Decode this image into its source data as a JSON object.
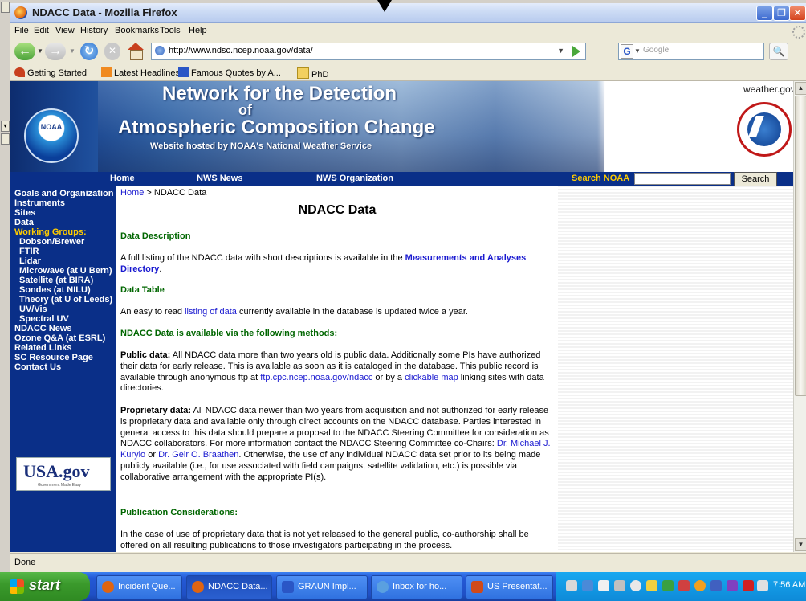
{
  "browser": {
    "title": "NDACC Data - Mozilla Firefox",
    "menu": [
      "File",
      "Edit",
      "View",
      "History",
      "Bookmarks",
      "Tools",
      "Help"
    ],
    "url": "http://www.ndsc.ncep.noaa.gov/data/",
    "search_placeholder": "Google",
    "bookmarks": [
      "Getting Started",
      "Latest Headlines",
      "Famous Quotes by A...",
      "PhD"
    ],
    "status": "Done"
  },
  "banner": {
    "line1": "Network for the Detection",
    "line2": "of",
    "line3": "Atmospheric Composition Change",
    "hosted": "Website hosted by NOAA's National Weather Service",
    "weather_gov": "weather.gov",
    "noaa_label": "NOAA"
  },
  "topnav": {
    "home": "Home",
    "nws_news": "NWS News",
    "nws_org": "NWS Organization",
    "search_label": "Search NOAA",
    "search_button": "Search"
  },
  "leftnav": {
    "items": [
      "Goals and Organization",
      "Instruments",
      "Sites",
      "Data",
      "Working Groups:",
      "Dobson/Brewer",
      "FTIR",
      "Lidar",
      "Microwave (at U Bern)",
      "Satellite (at BIRA)",
      "Sondes (at NILU)",
      "Theory (at U of Leeds)",
      "UV/Vis",
      "Spectral UV",
      "NDACC News",
      "Ozone Q&A (at ESRL)",
      "Related Links",
      "SC Resource Page",
      "Contact Us"
    ],
    "usagov": "USA.gov",
    "usagov_tag": "Government Made Easy"
  },
  "main": {
    "breadcrumb_home": "Home",
    "breadcrumb_rest": " > NDACC Data",
    "title": "NDACC Data",
    "h_desc": "Data Description",
    "desc_text": "A full listing of the NDACC data with short descriptions is available in the ",
    "desc_link": "Measurements and Analyses Directory",
    "h_table": "Data Table",
    "table_pre": "An easy to read ",
    "table_link": "listing of data",
    "table_post": " currently available in the database is updated twice a year.",
    "h_methods": "NDACC Data is available via the following methods:",
    "public_label": "Public data:",
    "public_text": " All NDACC data more than two years old is public data.  Additionally some PIs have authorized their data for early release.  This is available as soon as it is cataloged in the database.  This public record is available through anonymous ftp at ",
    "public_ftp": "ftp.cpc.ncep.noaa.gov/ndacc",
    "public_mid": " or by a ",
    "public_map": "clickable map",
    "public_end": " linking sites with data directories.",
    "prop_label": "Proprietary data:",
    "prop_text": " All NDACC data newer than two years from acquisition and not authorized for early release is proprietary data and available only through direct accounts on the NDACC database.  Parties interested in general access to this data should prepare a proposal to the NDACC Steering Committee for consideration as NDACC collaborators.  For more information contact the NDACC Steering Committee co-Chairs:  ",
    "prop_link1": "Dr. Michael J. Kurylo",
    "prop_or": " or ",
    "prop_link2": "Dr. Geir O. Braathen",
    "prop_end": ".  Otherwise, the use of any individual NDACC data set prior to its being made publicly available (i.e., for use associated with field campaigns, satellite validation, etc.) is possible via collaborative arrangement with the appropriate PI(s).",
    "h_pub": "Publication Considerations:",
    "pub_text": "In the case of use of proprietary data that is not yet released to the general public, co-authorship shall be offered on all resulting publications to those investigators participating in the process."
  },
  "taskbar": {
    "start": "start",
    "buttons": [
      "Incident Que...",
      "NDACC Data...",
      "GRAUN Impl...",
      "Inbox for ho...",
      "US Presentat..."
    ],
    "clock": "7:56 AM"
  }
}
